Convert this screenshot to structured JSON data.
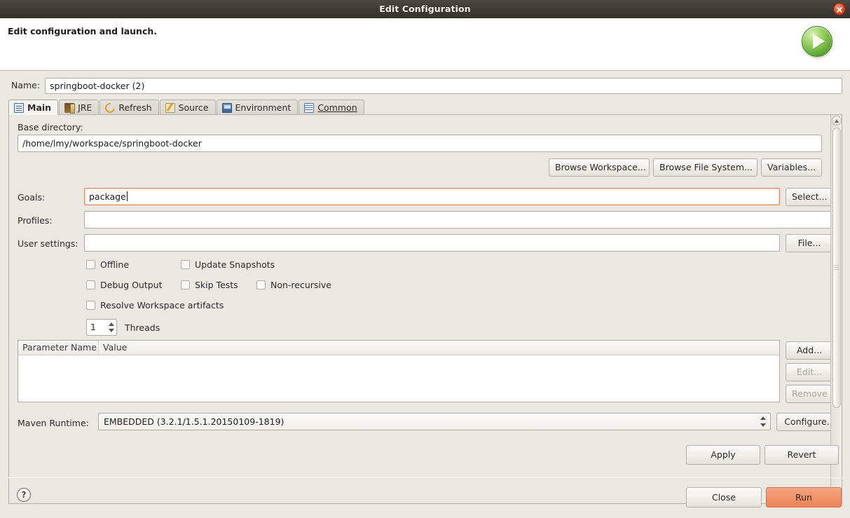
{
  "window": {
    "title": "Edit Configuration",
    "close_icon": "close-icon"
  },
  "header": {
    "title": "Edit configuration and launch.",
    "run_badge_icon": "run-play-icon"
  },
  "name_field": {
    "label": "Name:",
    "value": "springboot-docker (2)",
    "placeholder": ""
  },
  "tabs": [
    {
      "label": "Main",
      "icon": "main-tab-icon",
      "selected": true,
      "mnemonic": ""
    },
    {
      "label": "JRE",
      "icon": "jre-tab-icon",
      "selected": false,
      "mnemonic": ""
    },
    {
      "label": "Refresh",
      "icon": "refresh-tab-icon",
      "selected": false,
      "mnemonic": ""
    },
    {
      "label": "Source",
      "icon": "source-tab-icon",
      "selected": false,
      "mnemonic": ""
    },
    {
      "label": "Environment",
      "icon": "environment-tab-icon",
      "selected": false,
      "mnemonic": ""
    },
    {
      "label": "Common",
      "icon": "common-tab-icon",
      "selected": false,
      "mnemonic": "C"
    }
  ],
  "main_tab": {
    "base_directory": {
      "label": "Base directory:",
      "value": "/home/lmy/workspace/springboot-docker",
      "buttons": [
        "Browse Workspace...",
        "Browse File System...",
        "Variables..."
      ]
    },
    "goals": {
      "label": "Goals:",
      "value": "package",
      "focused": true,
      "button": "Select..."
    },
    "profiles": {
      "label": "Profiles:",
      "value": ""
    },
    "user_settings": {
      "label": "User settings:",
      "value": "",
      "button": "File..."
    },
    "checkboxes": [
      {
        "label": "Offline",
        "checked": false
      },
      {
        "label": "Update Snapshots",
        "checked": false
      },
      {
        "label": "Debug Output",
        "checked": false
      },
      {
        "label": "Skip Tests",
        "checked": false
      },
      {
        "label": "Non-recursive",
        "checked": false
      },
      {
        "label": "Resolve Workspace artifacts",
        "checked": false
      }
    ],
    "threads": {
      "value": "1",
      "label": "Threads"
    },
    "parameters_table": {
      "columns": [
        "Parameter Name",
        "Value"
      ],
      "rows": [],
      "buttons": [
        {
          "label": "Add...",
          "enabled": true
        },
        {
          "label": "Edit...",
          "enabled": false
        },
        {
          "label": "Remove",
          "enabled": false
        }
      ]
    },
    "maven_runtime": {
      "label": "Maven Runtime:",
      "value": "EMBEDDED (3.2.1/1.5.1.20150109-1819)",
      "button": "Configure..."
    }
  },
  "footer": {
    "apply_label": "Apply",
    "revert_label": "Revert",
    "close_label": "Close",
    "run_label": "Run",
    "help_icon": "help-icon",
    "help_glyph": "?"
  },
  "colors": {
    "accent_run": "#f09267",
    "focus_border": "#e08a63",
    "titlebar": "#413e3a",
    "dialog_bg": "#ebe8e4",
    "close_button": "#d84a2a",
    "run_badge_green": "#5fa832"
  }
}
